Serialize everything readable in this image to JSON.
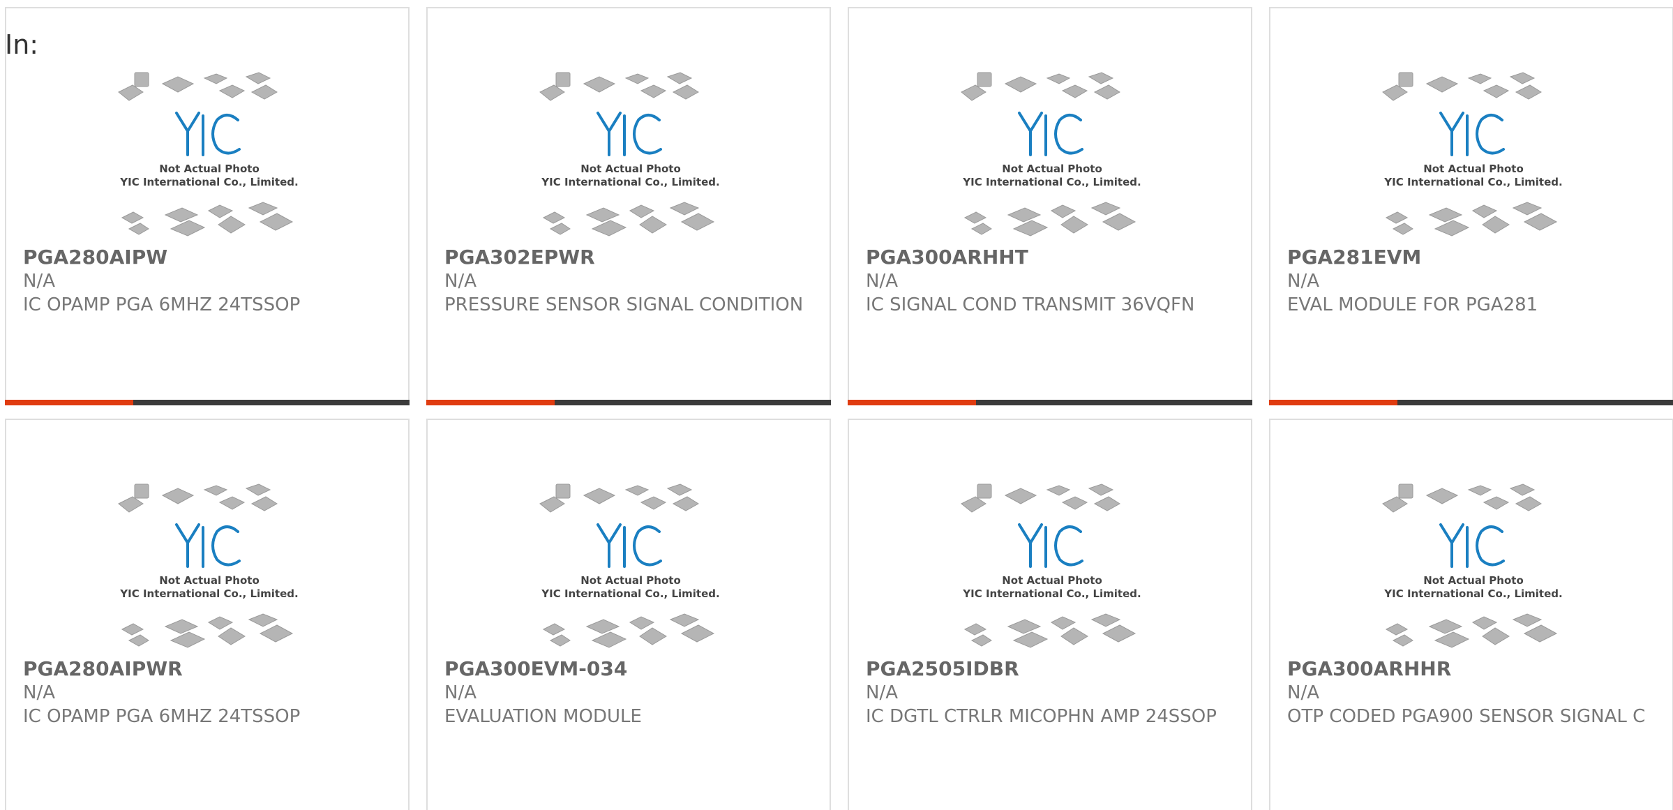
{
  "header": {
    "in_label": "In:"
  },
  "placeholder": {
    "line1": "Not Actual Photo",
    "line2": "YIC International Co., Limited.",
    "logo_text": "YIC"
  },
  "colors": {
    "accent": "#e03c10",
    "bar": "#3b3b3b",
    "logo": "#1a7fc1"
  },
  "products": [
    {
      "part": "PGA280AIPW",
      "mfr": "N/A",
      "desc": "IC OPAMP PGA 6MHZ 24TSSOP"
    },
    {
      "part": "PGA302EPWR",
      "mfr": "N/A",
      "desc": "PRESSURE SENSOR SIGNAL CONDITION"
    },
    {
      "part": "PGA300ARHHT",
      "mfr": "N/A",
      "desc": "IC SIGNAL COND TRANSMIT 36VQFN"
    },
    {
      "part": "PGA281EVM",
      "mfr": "N/A",
      "desc": "EVAL MODULE FOR PGA281"
    },
    {
      "part": "PGA280AIPWR",
      "mfr": "N/A",
      "desc": "IC OPAMP PGA 6MHZ 24TSSOP"
    },
    {
      "part": "PGA300EVM-034",
      "mfr": "N/A",
      "desc": "EVALUATION MODULE"
    },
    {
      "part": "PGA2505IDBR",
      "mfr": "N/A",
      "desc": "IC DGTL CTRLR MICOPHN AMP 24SSOP"
    },
    {
      "part": "PGA300ARHHR",
      "mfr": "N/A",
      "desc": "OTP CODED PGA900 SENSOR SIGNAL C"
    }
  ]
}
